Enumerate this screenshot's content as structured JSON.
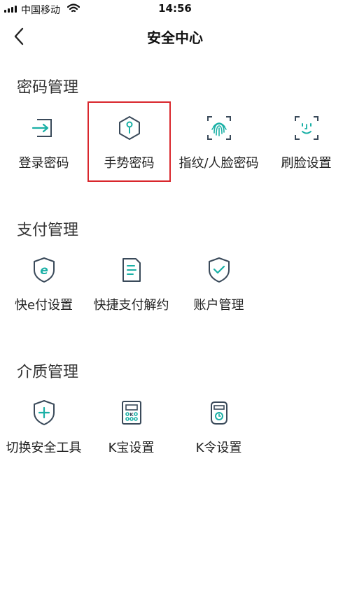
{
  "status_bar": {
    "carrier": "中国移动",
    "time": "14:56"
  },
  "nav": {
    "title": "安全中心"
  },
  "sections": [
    {
      "title": "密码管理",
      "items": [
        {
          "label": "登录密码",
          "icon": "login-arrow-icon"
        },
        {
          "label": "手势密码",
          "icon": "gesture-hexagon-icon",
          "selected": true
        },
        {
          "label": "指纹/人脸密码",
          "icon": "fingerprint-icon"
        },
        {
          "label": "刷脸设置",
          "icon": "face-scan-icon"
        }
      ]
    },
    {
      "title": "支付管理",
      "items": [
        {
          "label": "快e付设置",
          "icon": "e-pay-shield-icon"
        },
        {
          "label": "快捷支付解约",
          "icon": "document-icon"
        },
        {
          "label": "账户管理",
          "icon": "shield-check-icon"
        }
      ]
    },
    {
      "title": "介质管理",
      "items": [
        {
          "label": "切换安全工具",
          "icon": "shield-plus-icon"
        },
        {
          "label": "K宝设置",
          "icon": "k-bao-device-icon"
        },
        {
          "label": "K令设置",
          "icon": "k-ling-device-icon"
        }
      ]
    }
  ],
  "colors": {
    "accent": "#1ab0a6",
    "icon_dark": "#3a4a5a",
    "highlight": "#d9262c"
  }
}
